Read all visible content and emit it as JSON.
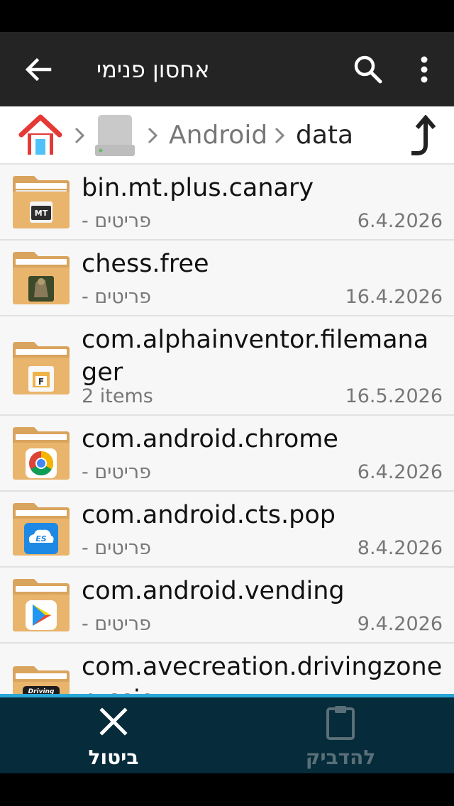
{
  "appbar": {
    "title": "אחסון פנימי"
  },
  "breadcrumb": {
    "items": [
      "Android",
      "data"
    ]
  },
  "files": [
    {
      "name": "bin.mt.plus.canary",
      "sub": "- פריטים",
      "date": "6.4.2026",
      "badge": "MT"
    },
    {
      "name": "chess.free",
      "sub": "- פריטים",
      "date": "16.4.2026",
      "badge": ""
    },
    {
      "name": "com.alphainventor.filemanager",
      "sub": "2 items",
      "date": "16.5.2026",
      "badge": "F"
    },
    {
      "name": "com.android.chrome",
      "sub": "- פריטים",
      "date": "6.4.2026",
      "badge": ""
    },
    {
      "name": "com.android.cts.pop",
      "sub": "- פריטים",
      "date": "8.4.2026",
      "badge": "ES"
    },
    {
      "name": "com.android.vending",
      "sub": "- פריטים",
      "date": "9.4.2026",
      "badge": ""
    },
    {
      "name": "com.avecreation.drivingzonerussia",
      "sub": "",
      "date": "",
      "badge": "Driving"
    }
  ],
  "bottombar": {
    "cancel_label": "ביטול",
    "paste_label": "להדביק"
  },
  "colors": {
    "appbar": "#242424",
    "bottombar": "#062b3a",
    "accent": "#2aa7d6",
    "folder": "#e9b46c"
  }
}
